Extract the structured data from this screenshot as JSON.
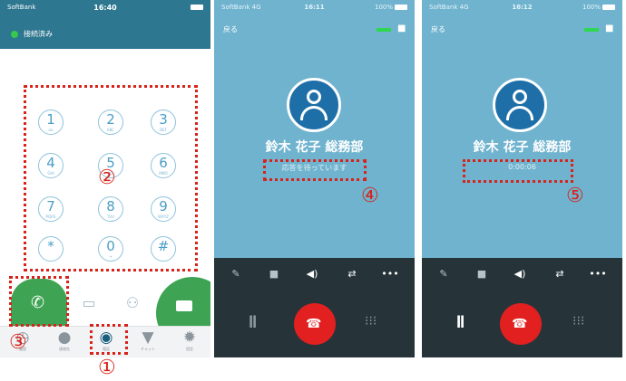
{
  "screen1": {
    "status": {
      "carrier": "SoftBank",
      "time": "16:40"
    },
    "connection_label": "接続済み",
    "keys": [
      {
        "digit": "1",
        "sub": "oo"
      },
      {
        "digit": "2",
        "sub": "ABC"
      },
      {
        "digit": "3",
        "sub": "DEF"
      },
      {
        "digit": "4",
        "sub": "GHI"
      },
      {
        "digit": "5",
        "sub": "JKL"
      },
      {
        "digit": "6",
        "sub": "MNO"
      },
      {
        "digit": "7",
        "sub": "PQRS"
      },
      {
        "digit": "8",
        "sub": "TUV"
      },
      {
        "digit": "9",
        "sub": "WXYZ"
      },
      {
        "digit": "*",
        "sub": ""
      },
      {
        "digit": "0",
        "sub": "+"
      },
      {
        "digit": "#",
        "sub": ""
      }
    ],
    "tabs": [
      {
        "label": "履歴",
        "icon": "history-icon"
      },
      {
        "label": "連絡先",
        "icon": "contacts-icon"
      },
      {
        "label": "電話",
        "icon": "phone-icon"
      },
      {
        "label": "チャット",
        "icon": "chat-icon"
      },
      {
        "label": "設定",
        "icon": "settings-icon"
      }
    ]
  },
  "screen2": {
    "status": {
      "carrier": "SoftBank 4G",
      "time": "16:11",
      "battery": "100%"
    },
    "back_label": "戻る",
    "caller_name": "鈴木 花子 総務部",
    "status_text": "応答を待っています"
  },
  "screen3": {
    "status": {
      "carrier": "SoftBank 4G",
      "time": "16:12",
      "battery": "100%"
    },
    "back_label": "戻る",
    "caller_name": "鈴木 花子 総務部",
    "duration": "0:00:06"
  },
  "annotations": {
    "n1": "①",
    "n2": "②",
    "n3": "③",
    "n4": "④",
    "n5": "⑤"
  },
  "colors": {
    "accent_red": "#d7231b",
    "call_green": "#3ea453",
    "call_bg": "#6fb3cf",
    "hangup_red": "#e1201f"
  }
}
